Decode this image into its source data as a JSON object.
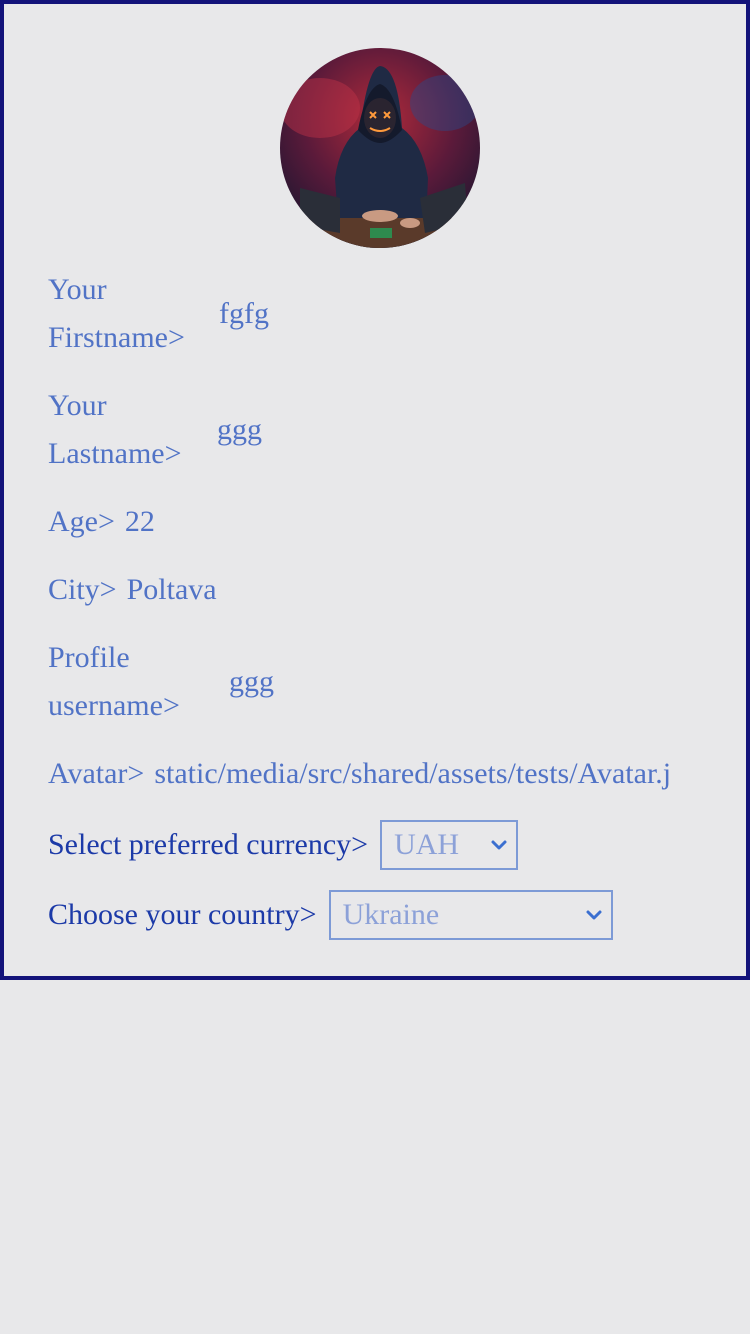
{
  "profile": {
    "avatar_icon": "hooded-hacker-avatar",
    "fields": {
      "firstname": {
        "label": "Your Firstname>",
        "value": "fgfg"
      },
      "lastname": {
        "label": "Your Lastname>",
        "value": "ggg"
      },
      "age": {
        "label": "Age>",
        "value": "22"
      },
      "city": {
        "label": "City>",
        "value": "Poltava"
      },
      "username": {
        "label": "Profile username>",
        "value": "ggg"
      },
      "avatar": {
        "label": "Avatar>",
        "value": "static/media/src/shared/assets/tests/Avatar.j"
      }
    },
    "currency": {
      "label": "Select preferred currency>",
      "selected": "UAH"
    },
    "country": {
      "label": "Choose your country>",
      "selected": "Ukraine"
    }
  },
  "colors": {
    "border": "#13137a",
    "label_light": "#5173c6",
    "label_dark": "#1c3aa8",
    "select_border": "#7d9ad6",
    "background": "#e8e8ea"
  }
}
